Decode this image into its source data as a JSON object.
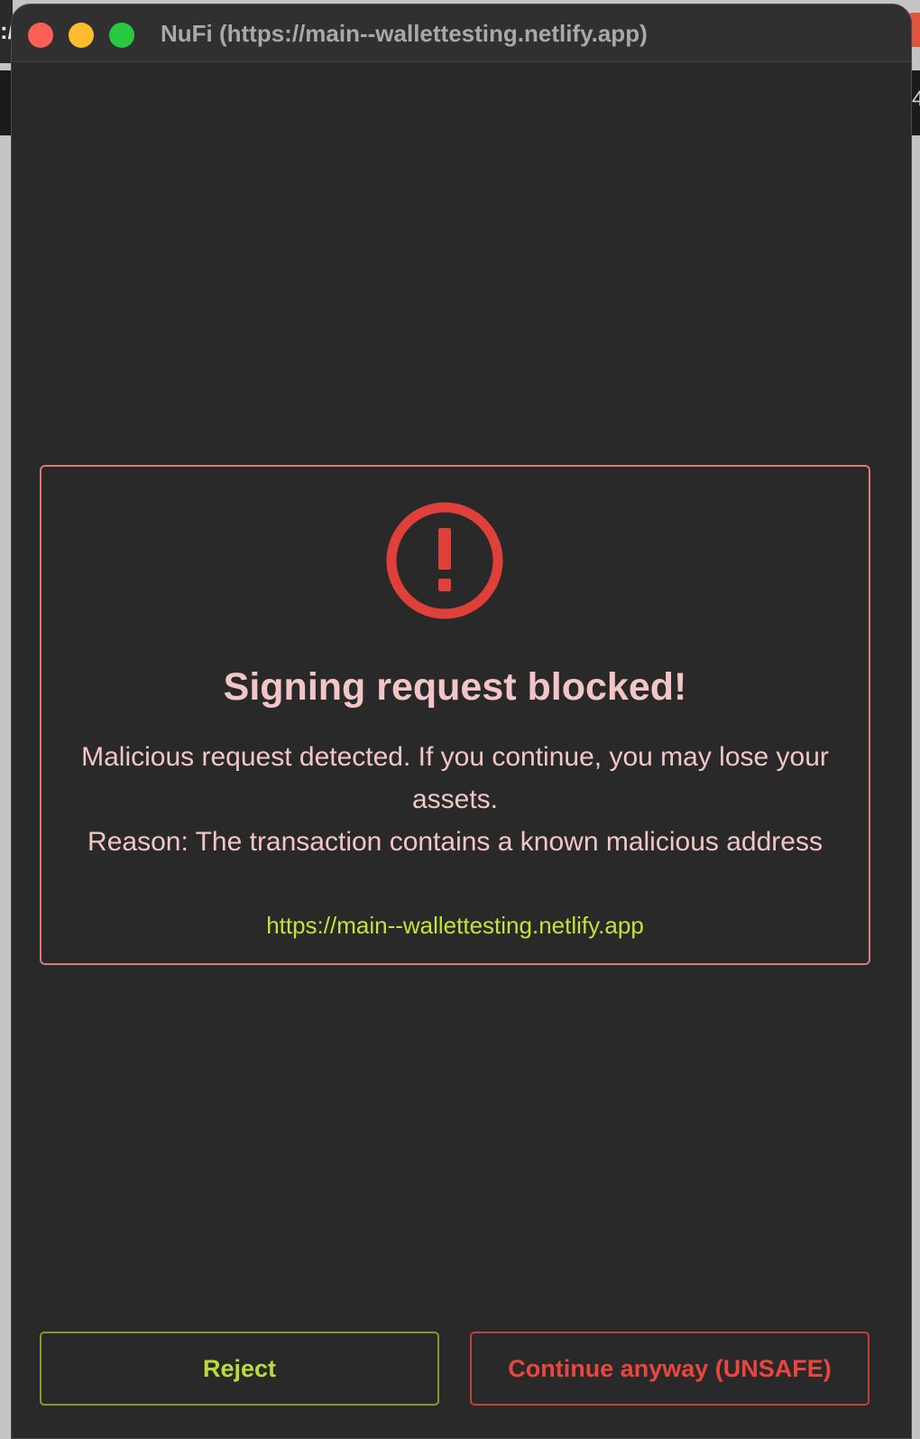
{
  "window": {
    "title": "NuFi (https://main--wallettesting.netlify.app)"
  },
  "background": {
    "left_glyph": ":/",
    "right_glyph": "4"
  },
  "warning": {
    "icon": "exclamation-circle-icon",
    "title": "Signing request blocked!",
    "message_line": "Malicious request detected. If you continue, you may lose your assets.",
    "reason_line": "Reason: The transaction contains a known malicious address",
    "origin": "https://main--wallettesting.netlify.app"
  },
  "actions": {
    "reject_label": "Reject",
    "continue_label": "Continue anyway (UNSAFE)"
  },
  "colors": {
    "background": "#292929",
    "warning_red": "#e0403a",
    "title_pink": "#f2c6c6",
    "origin_green": "#c2e23c",
    "reject_green": "#b8dc3a"
  }
}
